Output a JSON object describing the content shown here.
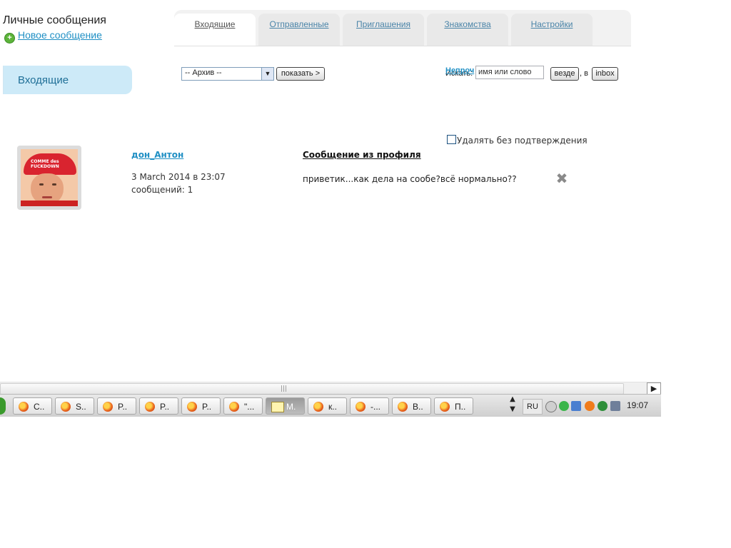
{
  "header": {
    "title": "Личные сообщения",
    "new_message": "Новое сообщение"
  },
  "tabs": [
    {
      "label": "Входящие"
    },
    {
      "label": "Отправленные"
    },
    {
      "label": "Приглашения"
    },
    {
      "label": "Знакомства"
    },
    {
      "label": "Настройки"
    }
  ],
  "sidebar": {
    "label": "Входящие"
  },
  "filters": {
    "archive_value": "-- Архив --",
    "show_button": "показать >",
    "unread_link": "Непроч",
    "search_label": "Искать:",
    "search_value": "имя или слово",
    "everywhere_button": "везде",
    "in_label": ", в",
    "inbox_button": "inbox"
  },
  "options": {
    "delete_without_confirm": "Удалять без подтверждения"
  },
  "message": {
    "sender": "дон_Антон",
    "date": "3 March 2014 в 23:07",
    "count": "сообщений: 1",
    "subject": "Сообщение из профиля",
    "preview": "приветик...как дела на сообе?всё нормально??",
    "avatar_text": "COMME des FUCKDOWN"
  },
  "taskbar": {
    "tasks": [
      {
        "label": "C..",
        "icon": "firefox-icon"
      },
      {
        "label": "S..",
        "icon": "firefox-icon"
      },
      {
        "label": "P..",
        "icon": "firefox-icon"
      },
      {
        "label": "P..",
        "icon": "firefox-icon"
      },
      {
        "label": "P..",
        "icon": "firefox-icon"
      },
      {
        "label": "\"...",
        "icon": "firefox-icon"
      },
      {
        "label": "M.",
        "icon": "mail-icon"
      },
      {
        "label": "к..",
        "icon": "firefox-icon"
      },
      {
        "label": "-...",
        "icon": "firefox-icon"
      },
      {
        "label": "B..",
        "icon": "firefox-icon"
      },
      {
        "label": "П..",
        "icon": "firefox-icon"
      }
    ],
    "language": "RU",
    "clock": "19:07"
  }
}
